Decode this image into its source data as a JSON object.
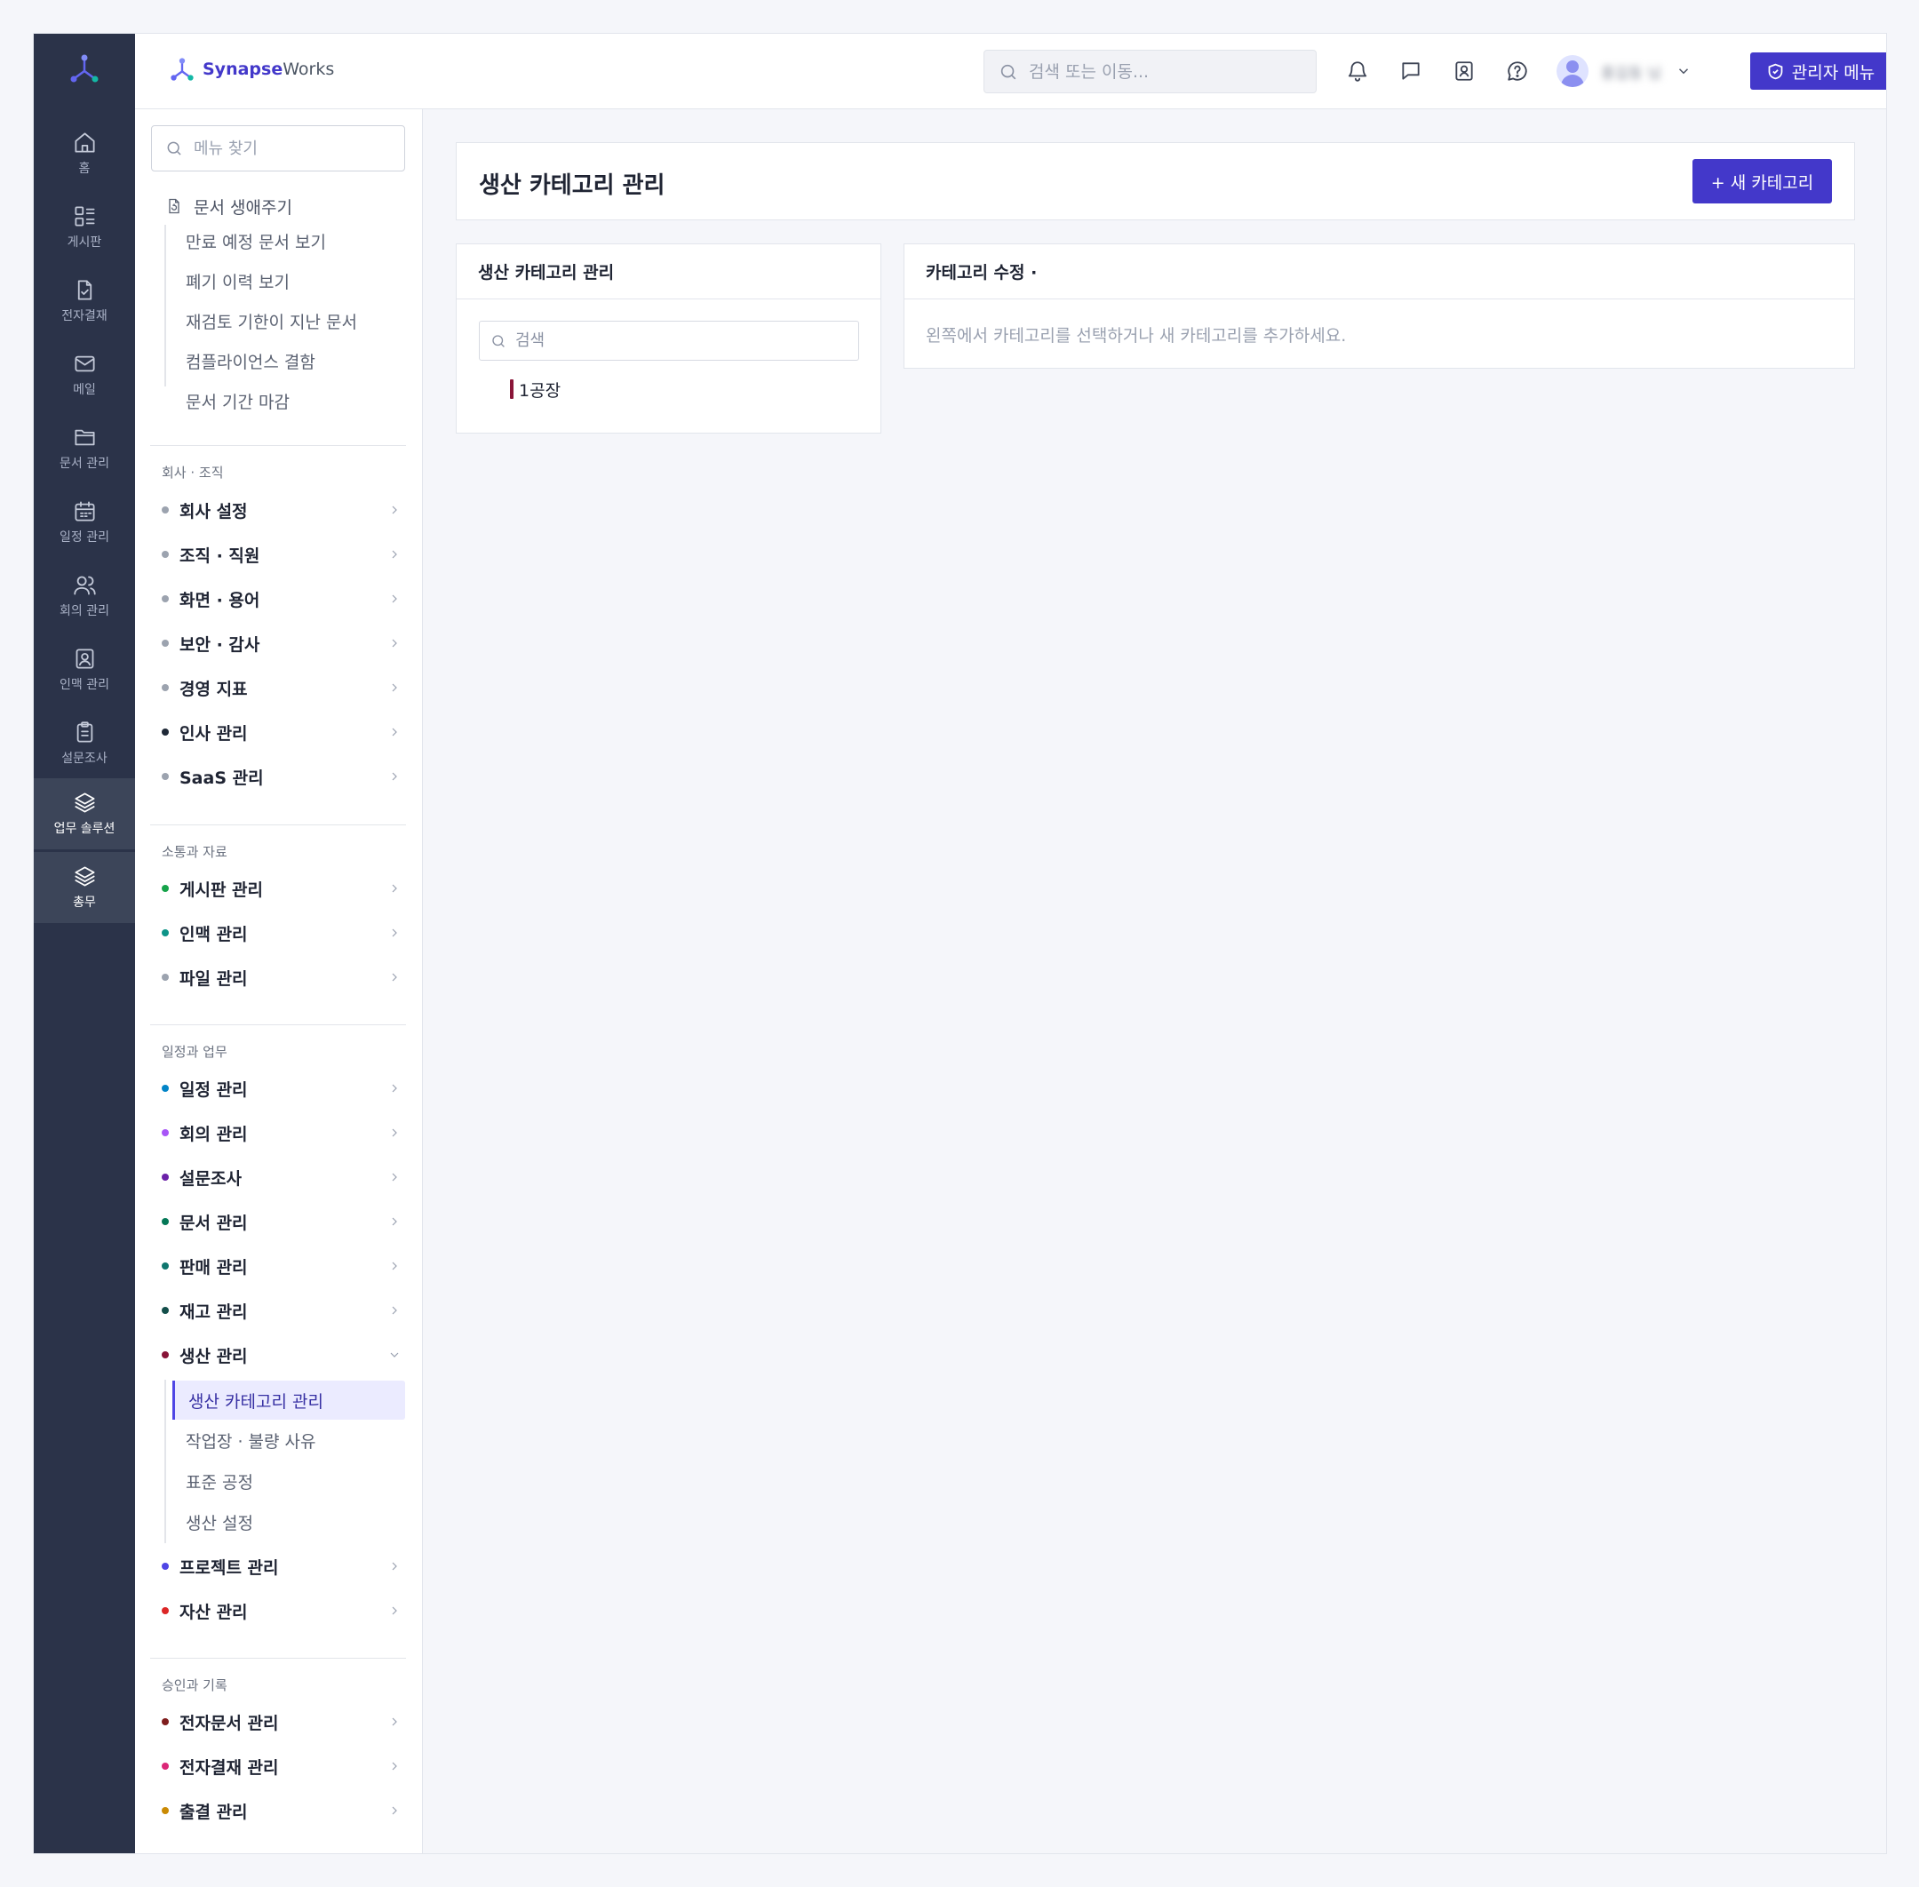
{
  "brand": {
    "name_bold": "Synapse",
    "name_rest": "Works"
  },
  "topbar": {
    "search_placeholder": "검색 또는 이동...",
    "user_name": "홍길동 님",
    "admin_label": "관리자 메뉴"
  },
  "rail": {
    "items": [
      {
        "label": "홈",
        "icon": "home-icon"
      },
      {
        "label": "게시판",
        "icon": "board-icon"
      },
      {
        "label": "전자결재",
        "icon": "approval-doc-icon"
      },
      {
        "label": "메일",
        "icon": "mail-icon"
      },
      {
        "label": "문서 관리",
        "icon": "folder-icon"
      },
      {
        "label": "일정 관리",
        "icon": "calendar-icon"
      },
      {
        "label": "회의 관리",
        "icon": "users-icon"
      },
      {
        "label": "인맥 관리",
        "icon": "contact-icon"
      },
      {
        "label": "설문조사",
        "icon": "clipboard-icon"
      },
      {
        "label": "업무 솔루션",
        "icon": "layers-icon",
        "active": true
      },
      {
        "label": "총무",
        "icon": "layers-icon"
      }
    ]
  },
  "sidebar": {
    "search_placeholder": "메뉴 찾기",
    "lifecycle": {
      "title": "문서 생애주기",
      "items": [
        "만료 예정 문서 보기",
        "폐기 이력 보기",
        "재검토 기한이 지난 문서",
        "컴플라이언스 결함",
        "문서 기간 마감"
      ]
    },
    "sections": [
      {
        "title": "회사 · 조직",
        "items": [
          {
            "label": "회사 설정",
            "color": "#9ca3af"
          },
          {
            "label": "조직 · 직원",
            "color": "#9ca3af"
          },
          {
            "label": "화면 · 용어",
            "color": "#9ca3af"
          },
          {
            "label": "보안 · 감사",
            "color": "#9ca3af"
          },
          {
            "label": "경영 지표",
            "color": "#9ca3af"
          },
          {
            "label": "인사 관리",
            "color": "#1f2937"
          },
          {
            "label": "SaaS 관리",
            "color": "#9ca3af"
          }
        ]
      },
      {
        "title": "소통과 자료",
        "items": [
          {
            "label": "게시판 관리",
            "color": "#16a34a"
          },
          {
            "label": "인맥 관리",
            "color": "#0d9488"
          },
          {
            "label": "파일 관리",
            "color": "#9ca3af"
          }
        ]
      },
      {
        "title": "일정과 업무",
        "items": [
          {
            "label": "일정 관리",
            "color": "#0284c7"
          },
          {
            "label": "회의 관리",
            "color": "#a855f7"
          },
          {
            "label": "설문조사",
            "color": "#6b21a8"
          },
          {
            "label": "문서 관리",
            "color": "#047857"
          },
          {
            "label": "판매 관리",
            "color": "#0f766e"
          },
          {
            "label": "재고 관리",
            "color": "#134e4a"
          },
          {
            "label": "생산 관리",
            "color": "#881337",
            "expanded": true
          },
          {
            "label": "프로젝트 관리",
            "color": "#4f46e5"
          },
          {
            "label": "자산 관리",
            "color": "#dc2626"
          }
        ],
        "production_sub": [
          "생산 카테고리 관리",
          "작업장 · 불량 사유",
          "표준 공정",
          "생산 설정"
        ]
      },
      {
        "title": "승인과 기록",
        "items": [
          {
            "label": "전자문서 관리",
            "color": "#7f1d1d"
          },
          {
            "label": "전자결재 관리",
            "color": "#db2777"
          },
          {
            "label": "출결 관리",
            "color": "#ca8a04"
          }
        ]
      }
    ]
  },
  "main": {
    "title": "생산 카테고리 관리",
    "new_button": "+ 새 카테고리",
    "list_panel": {
      "title": "생산 카테고리 관리",
      "search_placeholder": "검색",
      "items": [
        {
          "label": "1공장",
          "color": "#8a1538"
        }
      ]
    },
    "edit_panel": {
      "title": "카테고리 수정 ·",
      "empty": "왼쪽에서 카테고리를 선택하거나 새 카테고리를 추가하세요."
    }
  }
}
